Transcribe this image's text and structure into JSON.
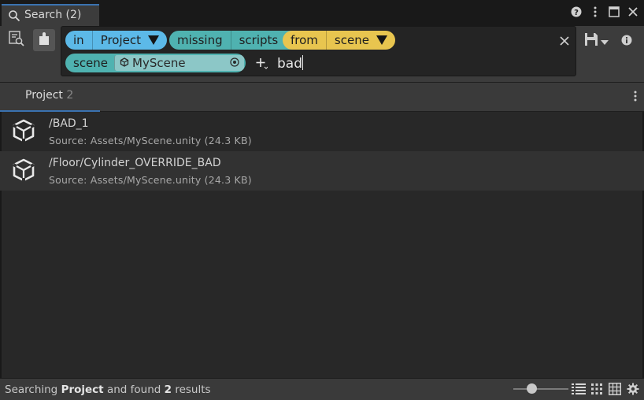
{
  "window": {
    "tab_title": "Search (2)"
  },
  "query": {
    "pills": [
      {
        "segments": [
          "in",
          "Project"
        ],
        "color": "#5cb9e8"
      },
      {
        "segments": [
          "missing",
          "scripts"
        ],
        "color": "#4fb2b0"
      },
      {
        "segments": [
          "from",
          "scene"
        ],
        "color": "#e8c54f"
      }
    ],
    "scene_filter": {
      "key": "scene",
      "value": "MyScene",
      "color": "#4fb2b0"
    },
    "text": "bad"
  },
  "providers": {
    "tabs": [
      {
        "label": "Project",
        "count": "2"
      }
    ]
  },
  "results": [
    {
      "title": "/BAD_1",
      "subtitle": "Source: Assets/MyScene.unity (24.3 KB)",
      "icon": "unity-gameobject-icon"
    },
    {
      "title": "/Floor/Cylinder_OVERRIDE_BAD",
      "subtitle": "Source: Assets/MyScene.unity (24.3 KB)",
      "icon": "unity-gameobject-icon"
    }
  ],
  "status": {
    "prefix": "Searching",
    "provider": "Project",
    "middle": "and found",
    "count": "2",
    "suffix": "results",
    "item_size_fraction": 0.3
  },
  "colors": {
    "accent": "#3a72b0",
    "background": "#282828",
    "panel": "#3c3c3c"
  }
}
